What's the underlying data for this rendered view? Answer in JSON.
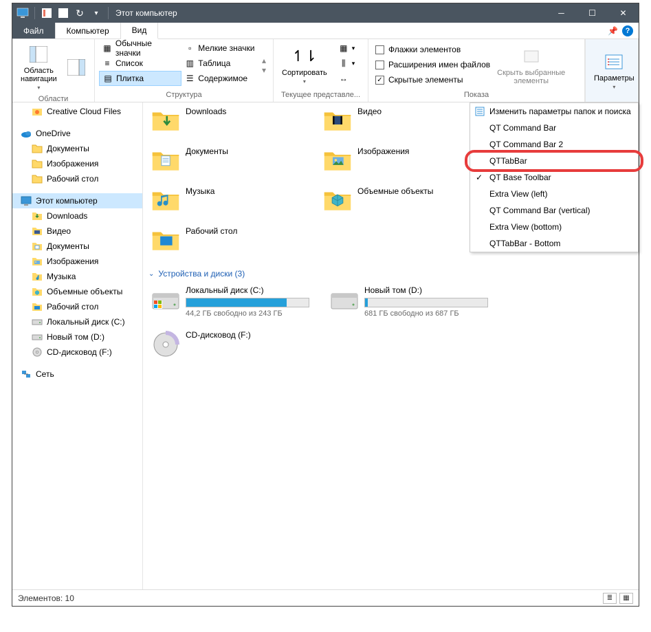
{
  "titlebar": {
    "title": "Этот компьютер"
  },
  "tabs": {
    "file": "Файл",
    "computer": "Компьютер",
    "view": "Вид"
  },
  "ribbon": {
    "nav_area": "Область\nнавигации",
    "group_areas": "Области",
    "layout": {
      "normal_icons": "Обычные значки",
      "small_icons": "Мелкие значки",
      "list": "Список",
      "table": "Таблица",
      "tile": "Плитка",
      "content": "Содержимое"
    },
    "group_structure": "Структура",
    "sort": "Сортировать",
    "group_current_view": "Текущее представле...",
    "checks": {
      "item_flags": "Флажки элементов",
      "filename_ext": "Расширения имен файлов",
      "hidden_items": "Скрытые элементы"
    },
    "hide_selected": "Скрыть выбранные\nэлементы",
    "group_show_hide": "Показа",
    "params": "Параметры"
  },
  "context_menu": {
    "items": [
      "Изменить параметры папок и поиска",
      "QT Command Bar",
      "QT Command Bar 2",
      "QTTabBar",
      "QT Base Toolbar",
      "Extra View (left)",
      "QT Command Bar (vertical)",
      "Extra View (bottom)",
      "QTTabBar - Bottom"
    ],
    "checked_index": 4,
    "highlight_index": 3
  },
  "sidebar": {
    "groups": [
      {
        "level": 2,
        "icon": "cloud-orange",
        "label": "Creative Cloud Files"
      },
      {
        "level": 1,
        "icon": "onedrive",
        "label": "OneDrive"
      },
      {
        "level": 2,
        "icon": "folder",
        "label": "Документы"
      },
      {
        "level": 2,
        "icon": "folder",
        "label": "Изображения"
      },
      {
        "level": 2,
        "icon": "folder",
        "label": "Рабочий стол"
      },
      {
        "level": 1,
        "icon": "this-pc",
        "label": "Этот компьютер",
        "selected": true
      },
      {
        "level": 2,
        "icon": "downloads",
        "label": "Downloads"
      },
      {
        "level": 2,
        "icon": "video",
        "label": "Видео"
      },
      {
        "level": 2,
        "icon": "documents",
        "label": "Документы"
      },
      {
        "level": 2,
        "icon": "pictures",
        "label": "Изображения"
      },
      {
        "level": 2,
        "icon": "music",
        "label": "Музыка"
      },
      {
        "level": 2,
        "icon": "objects3d",
        "label": "Объемные объекты"
      },
      {
        "level": 2,
        "icon": "desktop",
        "label": "Рабочий стол"
      },
      {
        "level": 2,
        "icon": "drive",
        "label": "Локальный диск (C:)"
      },
      {
        "level": 2,
        "icon": "drive",
        "label": "Новый том (D:)"
      },
      {
        "level": 2,
        "icon": "cd",
        "label": "CD-дисковод (F:)"
      },
      {
        "level": 1,
        "icon": "network",
        "label": "Сеть"
      }
    ]
  },
  "content": {
    "folders": [
      {
        "label": "Downloads",
        "icon": "downloads"
      },
      {
        "label": "Видео",
        "icon": "video"
      },
      {
        "label": "Документы",
        "icon": "documents"
      },
      {
        "label": "Изображения",
        "icon": "pictures"
      },
      {
        "label": "Музыка",
        "icon": "music"
      },
      {
        "label": "Объемные объекты",
        "icon": "objects3d"
      },
      {
        "label": "Рабочий стол",
        "icon": "desktop"
      }
    ],
    "section_header": "Устройства и диски (3)",
    "drives": [
      {
        "name": "Локальный диск (C:)",
        "free": "44,2 ГБ свободно из 243 ГБ",
        "fill": 82,
        "icon": "drive-c"
      },
      {
        "name": "Новый том (D:)",
        "free": "681 ГБ свободно из 687 ГБ",
        "fill": 2,
        "icon": "drive"
      },
      {
        "name": "CD-дисковод (F:)",
        "free": "",
        "fill": -1,
        "icon": "cd"
      }
    ]
  },
  "statusbar": {
    "items": "Элементов: 10"
  }
}
